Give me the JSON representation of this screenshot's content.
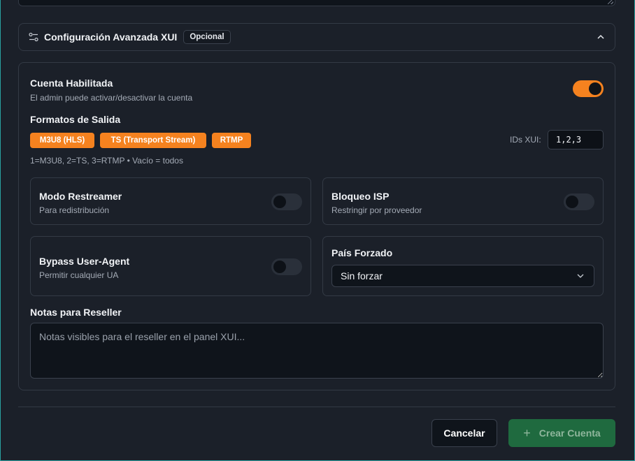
{
  "advanced": {
    "title": "Configuración Avanzada XUI",
    "badge": "Opcional"
  },
  "account": {
    "label": "Cuenta Habilitada",
    "description": "El admin puede activar/desactivar la cuenta",
    "enabled": true
  },
  "formats": {
    "label": "Formatos de Salida",
    "options": [
      "M3U8 (HLS)",
      "TS (Transport Stream)",
      "RTMP"
    ],
    "ids_label": "IDs XUI:",
    "ids_value": "1,2,3",
    "hint": "1=M3U8, 2=TS, 3=RTMP • Vacío = todos"
  },
  "restreamer": {
    "label": "Modo Restreamer",
    "description": "Para redistribución",
    "enabled": false
  },
  "isp": {
    "label": "Bloqueo ISP",
    "description": "Restringir por proveedor",
    "enabled": false
  },
  "bypass": {
    "label": "Bypass User-Agent",
    "description": "Permitir cualquier UA",
    "enabled": false
  },
  "country": {
    "label": "País Forzado",
    "selected": "Sin forzar"
  },
  "notes": {
    "label": "Notas para Reseller",
    "placeholder": "Notas visibles para el reseller en el panel XUI..."
  },
  "actions": {
    "cancel": "Cancelar",
    "create": "Crear Cuenta"
  },
  "colors": {
    "accent": "#f5821f",
    "success": "#1f6a3f",
    "background": "#1b2029"
  }
}
